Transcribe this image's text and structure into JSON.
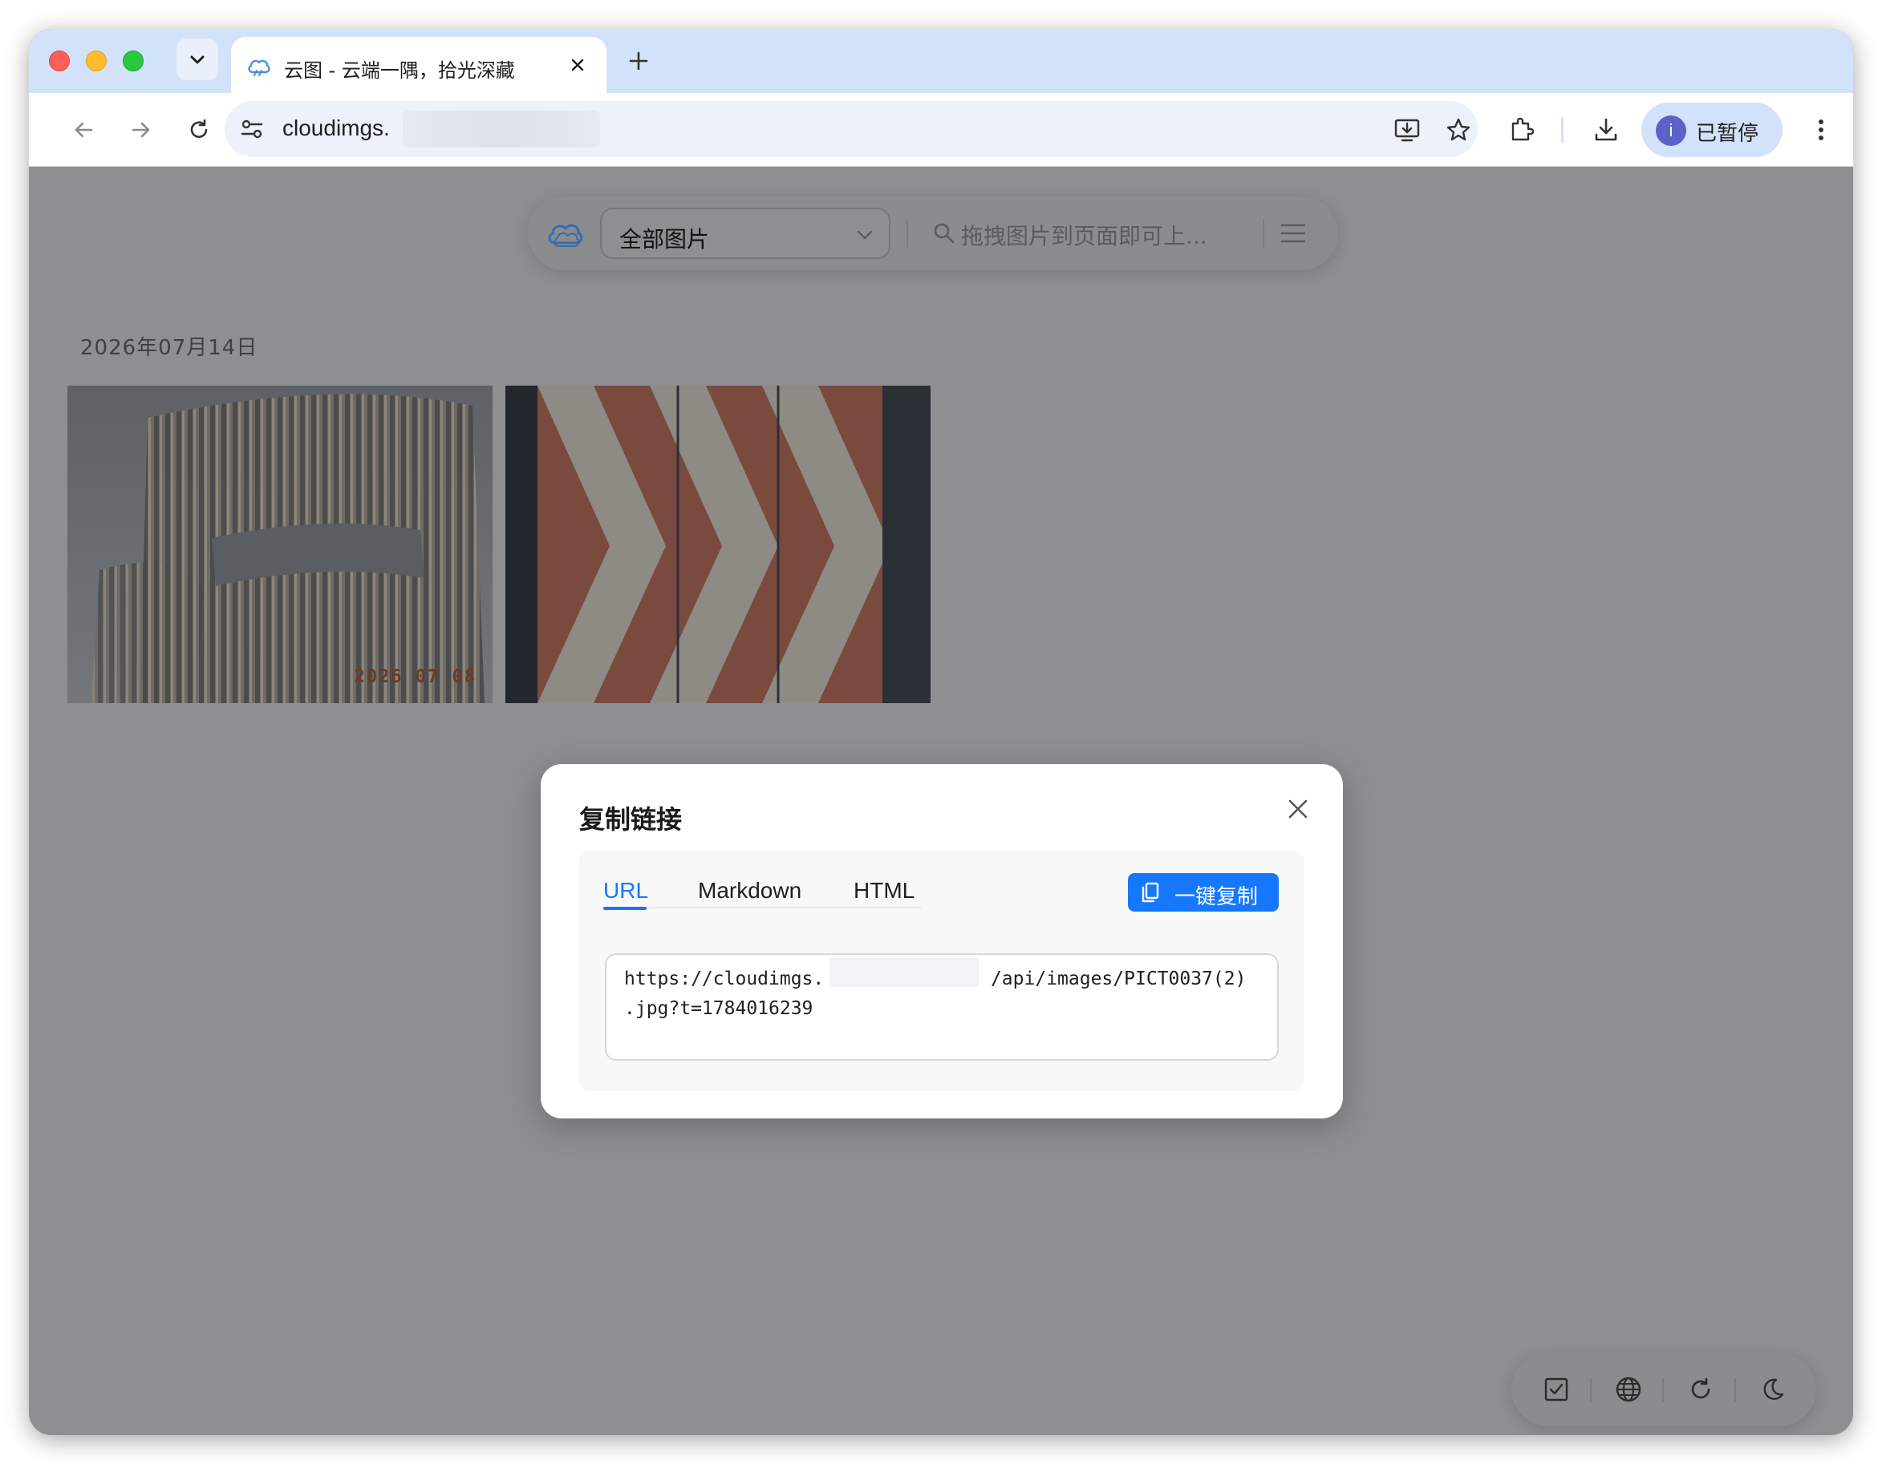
{
  "browser": {
    "tab": {
      "title": "云图 - 云端一隅，拾光深藏"
    },
    "address_bar": {
      "url_visible": "cloudimgs."
    },
    "profile": {
      "avatar_letter": "i",
      "status": "已暂停"
    }
  },
  "app": {
    "filter_select": {
      "value": "全部图片"
    },
    "search": {
      "placeholder": "拖拽图片到页面即可上..."
    },
    "gallery": {
      "date_group": "2026年07月14日",
      "images": [
        {
          "name": "building-photo",
          "stamp": "2026 07 08"
        },
        {
          "name": "chevron-pattern-photo"
        }
      ]
    }
  },
  "modal": {
    "title": "复制链接",
    "tabs": [
      {
        "label": "URL",
        "active": true
      },
      {
        "label": "Markdown",
        "active": false
      },
      {
        "label": "HTML",
        "active": false
      }
    ],
    "copy_button": "一键复制",
    "content_line1": "https://cloudimgs.               /api/images/PICT0037(2)",
    "content_line2": ".jpg?t=1784016239"
  },
  "colors": {
    "accent": "#1677ff",
    "tabstrip": "#d3e2fb",
    "overlay": "#8e8f91"
  },
  "icons": [
    "chevron-down-icon",
    "cloud-icon",
    "close-icon",
    "plus-icon",
    "back-icon",
    "forward-icon",
    "reload-icon",
    "site-settings-icon",
    "install-icon",
    "star-icon",
    "extensions-icon",
    "download-icon",
    "menu-dots-icon",
    "search-icon",
    "hamburger-icon",
    "checkbox-icon",
    "globe-icon",
    "refresh-icon",
    "moon-icon",
    "copy-icon"
  ]
}
